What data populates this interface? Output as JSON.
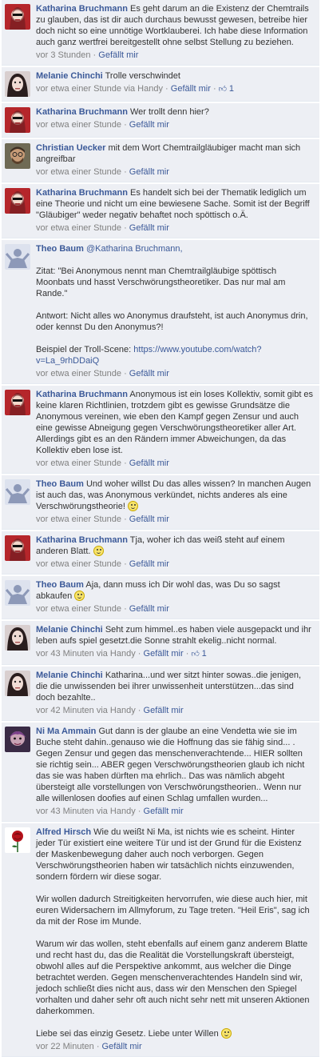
{
  "sep": " · ",
  "like_label": "Gefällt mir",
  "comments": [
    {
      "author": "Katharina Bruchmann",
      "text": [
        "Es geht darum an die Existenz der Chemtrails zu glauben, das ist dir auch durchaus bewusst gewesen, betreibe hier doch nicht so eine unnötige Wortklauberei. Ich habe diese Information auch ganz wertfrei bereitgestellt ohne selbst Stellung zu beziehen."
      ],
      "time": "vor 3 Stunden",
      "likes": ""
    },
    {
      "author": "Melanie Chinchi",
      "text": [
        "Trolle verschwindet"
      ],
      "time": "vor etwa einer Stunde via Handy",
      "likes": "1"
    },
    {
      "author": "Katharina Bruchmann",
      "text": [
        "Wer trollt denn hier?"
      ],
      "time": "vor etwa einer Stunde",
      "likes": ""
    },
    {
      "author": "Christian Uecker",
      "text": [
        "mit dem Wort Chemtrailgläubiger macht man sich angreifbar"
      ],
      "time": "vor etwa einer Stunde",
      "likes": ""
    },
    {
      "author": "Katharina Bruchmann",
      "text": [
        "Es handelt sich bei der Thematik lediglich um eine Theorie und nicht um eine bewiesene Sache. Somit ist der Begriff \"Gläubiger\" weder negativ behaftet noch spöttisch o.Ä."
      ],
      "time": "vor etwa einer Stunde",
      "likes": ""
    },
    {
      "author": "Theo Baum",
      "mention": "@Katharina Bruchmann,",
      "text": [
        "Zitat: \"Bei Anonymous nennt man Chemtrailgläubige spöttisch Moonbats und hasst Verschwörungstheoretiker. Das nur mal am Rande.\"",
        "Antwort: Nicht alles wo Anonymus draufsteht, ist auch Anonymus drin, oder kennst Du den Anonymus?!",
        "Beispiel der Troll-Scene:"
      ],
      "link": "https://www.youtube.com/watch?v=La_9rhDDaiQ",
      "time": "vor etwa einer Stunde",
      "likes": ""
    },
    {
      "author": "Katharina Bruchmann",
      "text": [
        "Anonymous ist ein loses Kollektiv, somit gibt es keine klaren Richtlinien, trotzdem gibt es gewisse Grundsätze die Anonymous vereinen, wie eben den Kampf gegen Zensur und auch eine gewisse Abneigung gegen Verschwörungstheoretiker aller Art. Allerdings gibt es an den Rändern immer Abweichungen, da das Kollektiv eben lose ist."
      ],
      "time": "vor etwa einer Stunde",
      "likes": ""
    },
    {
      "author": "Theo Baum",
      "text": [
        "Und woher willst Du das alles wissen? In manchen Augen ist auch das, was Anonymous verkündet, nichts anderes als eine Verschwörungstheorie!"
      ],
      "smiley": true,
      "time": "vor etwa einer Stunde",
      "likes": ""
    },
    {
      "author": "Katharina Bruchmann",
      "text": [
        "Tja, woher ich das weiß steht auf einem anderen Blatt."
      ],
      "smiley": true,
      "time": "vor etwa einer Stunde",
      "likes": ""
    },
    {
      "author": "Theo Baum",
      "text": [
        "Aja, dann muss ich Dir wohl das, was Du so sagst abkaufen"
      ],
      "smiley": true,
      "time": "vor etwa einer Stunde",
      "likes": ""
    },
    {
      "author": "Melanie Chinchi",
      "text": [
        "Seht zum himmel..es haben viele ausgepackt und ihr leben aufs spiel gesetzt.die Sonne strahlt ekelig..nicht normal."
      ],
      "time": "vor 43 Minuten via Handy",
      "likes": "1"
    },
    {
      "author": "Melanie Chinchi",
      "text": [
        "Katharina...und wer sitzt hinter sowas..die jenigen, die die unwissenden bei ihrer unwissenheit unterstützen...das sind doch bezahlte.."
      ],
      "time": "vor 42 Minuten via Handy",
      "likes": ""
    },
    {
      "author": "Ni Ma Ammain",
      "text": [
        "Gut dann is der glaube an eine Vendetta wie sie im Buche steht dahin..genauso wie die Hoffnung das sie fähig sind... . Gegen Zensur und gegen das menschenverachtende... HIER sollten sie richtig sein... ABER gegen Verschwörungstheorien glaub ich nicht das sie was haben dürften ma ehrlich.. Das was nämlich abgeht übersteigt alle vorstellungen von Verschwörungstheorien.. Wenn nur alle willenlosen doofies auf einen Schlag umfallen wurden..."
      ],
      "time": "vor 43 Minuten via Handy",
      "likes": ""
    },
    {
      "author": "Alfred Hirsch",
      "text": [
        "Wie du weißt Ni Ma, ist nichts wie es scheint. Hinter jeder Tür existiert eine weitere Tür und ist der Grund für die Existenz der Maskenbewegung daher auch noch verborgen. Gegen Verschwörungstheorien haben wir tatsächlich nichts einzuwenden, sondern fördern wir diese sogar.",
        "Wir wollen dadurch Streitigkeiten hervorrufen, wie diese auch hier, mit euren Widersachern im Allmyforum, zu Tage treten. \"Heil Eris\", sag ich da mit der Rose im Munde.",
        "Warum wir das wollen, steht ebenfalls auf einem ganz anderem Blatte und recht hast du, das die Realität die Vorstellungskraft übersteigt, obwohl alles auf die Perspektive ankommt, aus welcher die Dinge betrachtet werden. Gegen menschenverachtendes Handeln sind wir, jedoch schließt dies nicht aus, dass wir den Menschen den Spiegel vorhalten und daher sehr oft auch nicht sehr nett mit unseren Aktionen daherkommen.",
        "Liebe sei das einzig Gesetz. Liebe unter Willen"
      ],
      "smiley": true,
      "time": "vor 22 Minuten",
      "likes": ""
    }
  ]
}
